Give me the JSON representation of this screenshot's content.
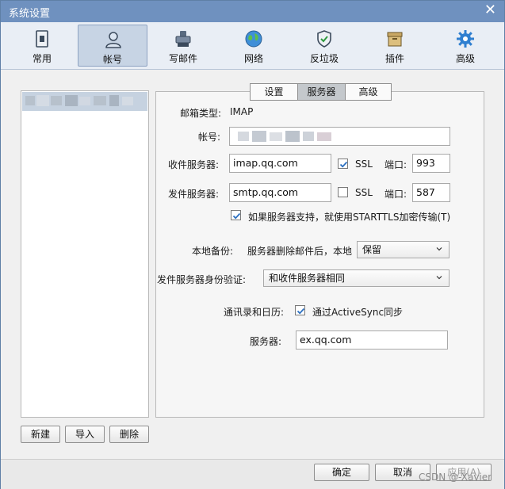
{
  "window": {
    "title": "系统设置"
  },
  "toolbar": {
    "items": [
      {
        "label": "常用",
        "icon": "general-icon"
      },
      {
        "label": "帐号",
        "icon": "account-icon"
      },
      {
        "label": "写邮件",
        "icon": "compose-icon"
      },
      {
        "label": "网络",
        "icon": "network-icon"
      },
      {
        "label": "反垃圾",
        "icon": "antispam-shield-icon"
      },
      {
        "label": "插件",
        "icon": "plugin-box-icon"
      },
      {
        "label": "高级",
        "icon": "gear-icon"
      }
    ],
    "active": "帐号"
  },
  "account_list": {
    "buttons": {
      "new": "新建",
      "import": "导入",
      "delete": "删除"
    }
  },
  "tabs": {
    "items": [
      "设置",
      "服务器",
      "高级"
    ],
    "active": "服务器"
  },
  "server": {
    "mailbox_type_label": "邮箱类型:",
    "mailbox_type_value": "IMAP",
    "account_label": "帐号:",
    "incoming_label": "收件服务器:",
    "incoming_value": "imap.qq.com",
    "incoming_ssl_label": "SSL",
    "incoming_ssl_checked": true,
    "incoming_port_label": "端口:",
    "incoming_port": "993",
    "outgoing_label": "发件服务器:",
    "outgoing_value": "smtp.qq.com",
    "outgoing_ssl_label": "SSL",
    "outgoing_ssl_checked": false,
    "outgoing_port_label": "端口:",
    "outgoing_port": "587",
    "starttls_label": "如果服务器支持，就使用STARTTLS加密传输(T)",
    "starttls_checked": true,
    "backup_label": "本地备份:",
    "backup_desc": "服务器删除邮件后，本地",
    "backup_value": "保留",
    "auth_label": "发件服务器身份验证:",
    "auth_value": "和收件服务器相同",
    "contacts_label": "通讯录和日历:",
    "activesync_label": "通过ActiveSync同步",
    "activesync_checked": true,
    "sync_server_label": "服务器:",
    "sync_server_value": "ex.qq.com"
  },
  "footer": {
    "ok": "确定",
    "cancel": "取消",
    "apply": "应用(A)"
  },
  "watermark": "CSDN @-Xavier",
  "colors": {
    "titlebar": "#6f91bf",
    "accent_check": "#2b6fc0"
  }
}
